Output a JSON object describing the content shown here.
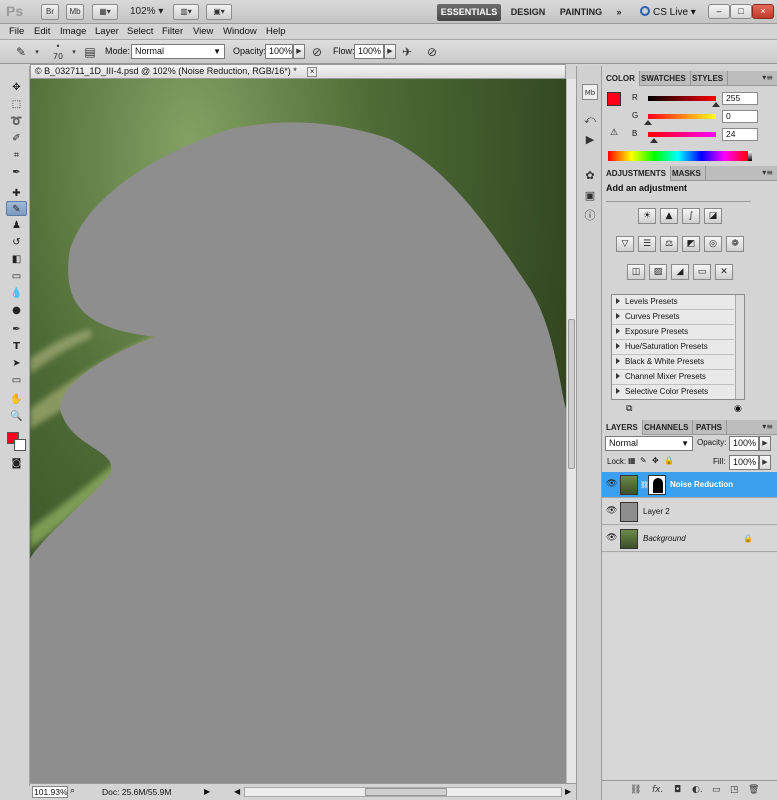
{
  "titlebar": {
    "logo": "Ps",
    "buttons": [
      "Br",
      "Mb"
    ],
    "zoom": "102%",
    "workspaces": [
      "ESSENTIALS",
      "DESIGN",
      "PAINTING"
    ],
    "more": "»",
    "cs_live": "CS Live",
    "window_controls": [
      "–",
      "□",
      "×"
    ]
  },
  "menu": [
    "File",
    "Edit",
    "Image",
    "Layer",
    "Select",
    "Filter",
    "View",
    "Window",
    "Help"
  ],
  "options": {
    "brush_size": "70",
    "mode_label": "Mode:",
    "mode_value": "Normal",
    "opacity_label": "Opacity:",
    "opacity_value": "100%",
    "flow_label": "Flow:",
    "flow_value": "100%"
  },
  "document": {
    "tab_title": "© B_032711_1D_III-4.psd @ 102% (Noise Reduction, RGB/16*) *",
    "close": "×",
    "zoom": "101.93%",
    "doc_info": "Doc: 25.6M/55.9M"
  },
  "color_panel": {
    "tabs": [
      "COLOR",
      "SWATCHES",
      "STYLES"
    ],
    "channels": [
      {
        "label": "R",
        "value": "255",
        "level": 1.0
      },
      {
        "label": "G",
        "value": "0",
        "level": 0.0
      },
      {
        "label": "B",
        "value": "24",
        "level": 0.094
      }
    ],
    "foreground": "#ff0018"
  },
  "adjustments_panel": {
    "tabs": [
      "ADJUSTMENTS",
      "MASKS"
    ],
    "title": "Add an adjustment",
    "presets": [
      "Levels Presets",
      "Curves Presets",
      "Exposure Presets",
      "Hue/Saturation Presets",
      "Black & White Presets",
      "Channel Mixer Presets",
      "Selective Color Presets"
    ]
  },
  "layers_panel": {
    "tabs": [
      "LAYERS",
      "CHANNELS",
      "PATHS"
    ],
    "blend_mode": "Normal",
    "opacity_label": "Opacity:",
    "opacity_value": "100%",
    "lock_label": "Lock:",
    "fill_label": "Fill:",
    "fill_value": "100%",
    "layers": [
      {
        "name": "Noise Reduction",
        "selected": true
      },
      {
        "name": "Layer 2",
        "selected": false
      },
      {
        "name": "Background",
        "selected": false,
        "locked": true
      }
    ],
    "footer_icons": [
      "link-icon",
      "fx-icon",
      "mask-icon",
      "adjustment-icon",
      "folder-icon",
      "new-layer-icon",
      "trash-icon"
    ]
  },
  "colors": {
    "selected_layer": "#3ba0f0",
    "workspace_active": "#4e4e4e"
  }
}
